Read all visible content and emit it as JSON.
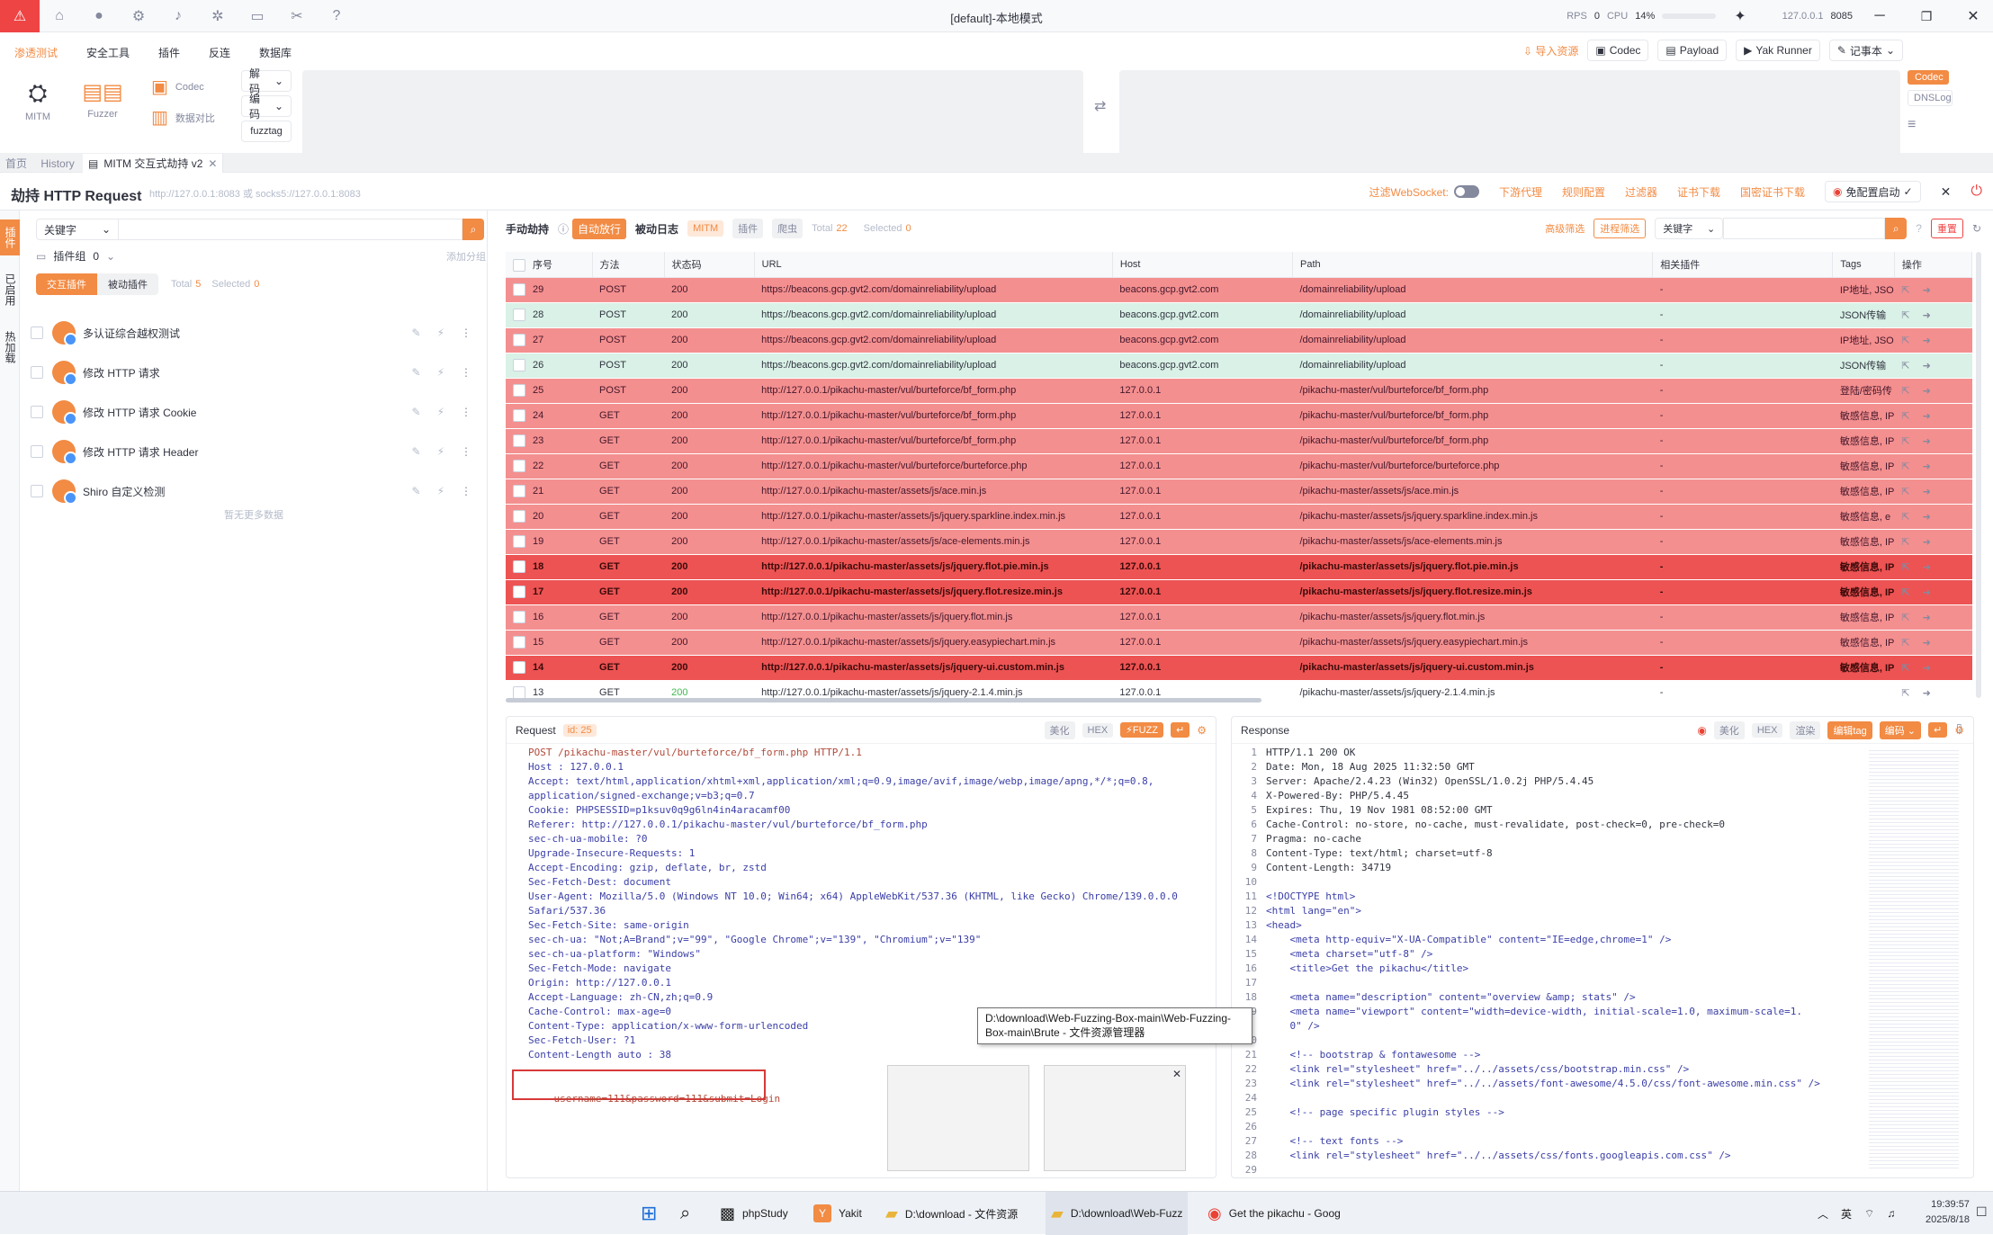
{
  "window": {
    "title": "[default]-本地模式",
    "rps_label": "RPS",
    "rps": "0",
    "cpu_label": "CPU",
    "cpu": "14%",
    "ip": "127.0.0.1",
    "port": "8085"
  },
  "menu": {
    "items": [
      "渗透测试",
      "安全工具",
      "插件",
      "反连",
      "数据库"
    ],
    "tools": {
      "mitm": "MITM",
      "fuzzer": "Fuzzer",
      "codec": "Codec",
      "compare": "数据对比"
    },
    "decode": "解码",
    "encode": "编码",
    "fuzztag": "fuzztag",
    "right": {
      "import": "导入资源",
      "codec": "Codec",
      "payload": "Payload",
      "yakrunner": "Yak Runner",
      "notebook": "记事本"
    },
    "side_tags": {
      "codec": "Codec",
      "dnslog": "DNSLog"
    }
  },
  "tabs": [
    {
      "label": "首页"
    },
    {
      "label": "History"
    },
    {
      "label": "MITM 交互式劫持 v2"
    }
  ],
  "mitm_header": {
    "title": "劫持 HTTP Request",
    "address": "http://127.0.0.1:8083 或 socks5://127.0.0.1:8083",
    "websocket_filter": "过滤WebSocket:",
    "downstream_proxy": "下游代理",
    "rule_config": "规则配置",
    "filter": "过滤器",
    "cert_download": "证书下载",
    "gm_cert_download": "国密证书下载",
    "no_config_start": "免配置启动"
  },
  "left_vtabs": [
    "插件",
    "已启用",
    "热加载"
  ],
  "left_panel": {
    "keyword": "关键字",
    "plugin_group": "插件组",
    "plugin_group_count": "0",
    "add_group": "添加分组",
    "tab_interactive": "交互插件",
    "tab_passive": "被动插件",
    "total_label": "Total",
    "total": "5",
    "selected_label": "Selected",
    "selected": "0",
    "plugins": [
      "多认证综合越权测试",
      "修改 HTTP 请求",
      "修改 HTTP 请求 Cookie",
      "修改 HTTP 请求 Header",
      "Shiro 自定义检测"
    ],
    "no_more": "暂无更多数据"
  },
  "toolbar": {
    "manual": "手动劫持",
    "auto": "自动放行",
    "passive_log": "被动日志",
    "mitm": "MITM",
    "plugin": "插件",
    "crawler": "爬虫",
    "total_label": "Total",
    "total": "22",
    "selected_label": "Selected",
    "selected": "0",
    "advanced_filter": "高级筛选",
    "process_filter": "进程筛选",
    "keyword": "关键字",
    "reset": "重置"
  },
  "table": {
    "columns": [
      "序号",
      "方法",
      "状态码",
      "URL",
      "Host",
      "Path",
      "相关插件",
      "Tags",
      "操作"
    ],
    "rows": [
      {
        "id": "29",
        "method": "POST",
        "status": "200",
        "url": "https://beacons.gcp.gvt2.com/domainreliability/upload",
        "host": "beacons.gcp.gvt2.com",
        "path": "/domainreliability/upload",
        "plugin": "-",
        "tags": "IP地址, JSO",
        "style": "red"
      },
      {
        "id": "28",
        "method": "POST",
        "status": "200",
        "url": "https://beacons.gcp.gvt2.com/domainreliability/upload",
        "host": "beacons.gcp.gvt2.com",
        "path": "/domainreliability/upload",
        "plugin": "-",
        "tags": "JSON传输",
        "style": "green"
      },
      {
        "id": "27",
        "method": "POST",
        "status": "200",
        "url": "https://beacons.gcp.gvt2.com/domainreliability/upload",
        "host": "beacons.gcp.gvt2.com",
        "path": "/domainreliability/upload",
        "plugin": "-",
        "tags": "IP地址, JSO",
        "style": "red"
      },
      {
        "id": "26",
        "method": "POST",
        "status": "200",
        "url": "https://beacons.gcp.gvt2.com/domainreliability/upload",
        "host": "beacons.gcp.gvt2.com",
        "path": "/domainreliability/upload",
        "plugin": "-",
        "tags": "JSON传输",
        "style": "green"
      },
      {
        "id": "25",
        "method": "POST",
        "status": "200",
        "url": "http://127.0.0.1/pikachu-master/vul/burteforce/bf_form.php",
        "host": "127.0.0.1",
        "path": "/pikachu-master/vul/burteforce/bf_form.php",
        "plugin": "-",
        "tags": "登陆/密码传",
        "style": "red"
      },
      {
        "id": "24",
        "method": "GET",
        "status": "200",
        "url": "http://127.0.0.1/pikachu-master/vul/burteforce/bf_form.php",
        "host": "127.0.0.1",
        "path": "/pikachu-master/vul/burteforce/bf_form.php",
        "plugin": "-",
        "tags": "敏感信息, IP",
        "style": "red"
      },
      {
        "id": "23",
        "method": "GET",
        "status": "200",
        "url": "http://127.0.0.1/pikachu-master/vul/burteforce/bf_form.php",
        "host": "127.0.0.1",
        "path": "/pikachu-master/vul/burteforce/bf_form.php",
        "plugin": "-",
        "tags": "敏感信息, IP",
        "style": "red"
      },
      {
        "id": "22",
        "method": "GET",
        "status": "200",
        "url": "http://127.0.0.1/pikachu-master/vul/burteforce/burteforce.php",
        "host": "127.0.0.1",
        "path": "/pikachu-master/vul/burteforce/burteforce.php",
        "plugin": "-",
        "tags": "敏感信息, IP",
        "style": "red"
      },
      {
        "id": "21",
        "method": "GET",
        "status": "200",
        "url": "http://127.0.0.1/pikachu-master/assets/js/ace.min.js",
        "host": "127.0.0.1",
        "path": "/pikachu-master/assets/js/ace.min.js",
        "plugin": "-",
        "tags": "敏感信息, IP",
        "style": "red"
      },
      {
        "id": "20",
        "method": "GET",
        "status": "200",
        "url": "http://127.0.0.1/pikachu-master/assets/js/jquery.sparkline.index.min.js",
        "host": "127.0.0.1",
        "path": "/pikachu-master/assets/js/jquery.sparkline.index.min.js",
        "plugin": "-",
        "tags": "敏感信息, e",
        "style": "red"
      },
      {
        "id": "19",
        "method": "GET",
        "status": "200",
        "url": "http://127.0.0.1/pikachu-master/assets/js/ace-elements.min.js",
        "host": "127.0.0.1",
        "path": "/pikachu-master/assets/js/ace-elements.min.js",
        "plugin": "-",
        "tags": "敏感信息, IP",
        "style": "red"
      },
      {
        "id": "18",
        "method": "GET",
        "status": "200",
        "url": "http://127.0.0.1/pikachu-master/assets/js/jquery.flot.pie.min.js",
        "host": "127.0.0.1",
        "path": "/pikachu-master/assets/js/jquery.flot.pie.min.js",
        "plugin": "-",
        "tags": "敏感信息, IP",
        "style": "red2"
      },
      {
        "id": "17",
        "method": "GET",
        "status": "200",
        "url": "http://127.0.0.1/pikachu-master/assets/js/jquery.flot.resize.min.js",
        "host": "127.0.0.1",
        "path": "/pikachu-master/assets/js/jquery.flot.resize.min.js",
        "plugin": "-",
        "tags": "敏感信息, IP",
        "style": "red2"
      },
      {
        "id": "16",
        "method": "GET",
        "status": "200",
        "url": "http://127.0.0.1/pikachu-master/assets/js/jquery.flot.min.js",
        "host": "127.0.0.1",
        "path": "/pikachu-master/assets/js/jquery.flot.min.js",
        "plugin": "-",
        "tags": "敏感信息, IP",
        "style": "red"
      },
      {
        "id": "15",
        "method": "GET",
        "status": "200",
        "url": "http://127.0.0.1/pikachu-master/assets/js/jquery.easypiechart.min.js",
        "host": "127.0.0.1",
        "path": "/pikachu-master/assets/js/jquery.easypiechart.min.js",
        "plugin": "-",
        "tags": "敏感信息, IP",
        "style": "red"
      },
      {
        "id": "14",
        "method": "GET",
        "status": "200",
        "url": "http://127.0.0.1/pikachu-master/assets/js/jquery-ui.custom.min.js",
        "host": "127.0.0.1",
        "path": "/pikachu-master/assets/js/jquery-ui.custom.min.js",
        "plugin": "-",
        "tags": "敏感信息, IP",
        "style": "red2"
      },
      {
        "id": "13",
        "method": "GET",
        "status": "200",
        "url": "http://127.0.0.1/pikachu-master/assets/js/jquery-2.1.4.min.js",
        "host": "127.0.0.1",
        "path": "/pikachu-master/assets/js/jquery-2.1.4.min.js",
        "plugin": "-",
        "tags": "",
        "style": "white"
      }
    ]
  },
  "request": {
    "title": "Request",
    "id_label": "id: 25",
    "beautify": "美化",
    "hex": "HEX",
    "fuzz": "FUZZ",
    "lines": [
      "POST /pikachu-master/vul/burteforce/bf_form.php HTTP/1.1",
      "Host : 127.0.0.1",
      "Accept: text/html,application/xhtml+xml,application/xml;q=0.9,image/avif,image/webp,image/apng,*/*;q=0.8,",
      "application/signed-exchange;v=b3;q=0.7",
      "Cookie: PHPSESSID=p1ksuv0q9g6ln4in4aracamf00",
      "Referer: http://127.0.0.1/pikachu-master/vul/burteforce/bf_form.php",
      "sec-ch-ua-mobile: ?0",
      "Upgrade-Insecure-Requests: 1",
      "Accept-Encoding: gzip, deflate, br, zstd",
      "Sec-Fetch-Dest: document",
      "User-Agent: Mozilla/5.0 (Windows NT 10.0; Win64; x64) AppleWebKit/537.36 (KHTML, like Gecko) Chrome/139.0.0.0",
      "Safari/537.36",
      "Sec-Fetch-Site: same-origin",
      "sec-ch-ua: \"Not;A=Brand\";v=\"99\", \"Google Chrome\";v=\"139\", \"Chromium\";v=\"139\"",
      "sec-ch-ua-platform: \"Windows\"",
      "Sec-Fetch-Mode: navigate",
      "Origin: http://127.0.0.1",
      "Accept-Language: zh-CN,zh;q=0.9",
      "Cache-Control: max-age=0",
      "Content-Type: application/x-www-form-urlencoded",
      "Sec-Fetch-User: ?1",
      "Content-Length auto : 38"
    ],
    "body": "username=111&password=111&submit=Login"
  },
  "response": {
    "title": "Response",
    "beautify": "美化",
    "hex": "HEX",
    "render": "渲染",
    "edit_tag": "编辑tag",
    "encode": "编码",
    "lines": [
      {
        "n": "1",
        "t": "HTTP/1.1 200 OK"
      },
      {
        "n": "2",
        "t": "Date: Mon, 18 Aug 2025 11:32:50 GMT"
      },
      {
        "n": "3",
        "t": "Server: Apache/2.4.23 (Win32) OpenSSL/1.0.2j PHP/5.4.45"
      },
      {
        "n": "4",
        "t": "X-Powered-By: PHP/5.4.45"
      },
      {
        "n": "5",
        "t": "Expires: Thu, 19 Nov 1981 08:52:00 GMT"
      },
      {
        "n": "6",
        "t": "Cache-Control: no-store, no-cache, must-revalidate, post-check=0, pre-check=0"
      },
      {
        "n": "7",
        "t": "Pragma: no-cache"
      },
      {
        "n": "8",
        "t": "Content-Type: text/html; charset=utf-8"
      },
      {
        "n": "9",
        "t": "Content-Length: 34719"
      },
      {
        "n": "10",
        "t": ""
      },
      {
        "n": "11",
        "t": "<!DOCTYPE html>"
      },
      {
        "n": "12",
        "t": "<html lang=\"en\">"
      },
      {
        "n": "13",
        "t": "<head>"
      },
      {
        "n": "14",
        "t": "    <meta http-equiv=\"X-UA-Compatible\" content=\"IE=edge,chrome=1\" />"
      },
      {
        "n": "15",
        "t": "    <meta charset=\"utf-8\" />"
      },
      {
        "n": "16",
        "t": "    <title>Get the pikachu</title>"
      },
      {
        "n": "17",
        "t": ""
      },
      {
        "n": "18",
        "t": "    <meta name=\"description\" content=\"overview &amp; stats\" />"
      },
      {
        "n": "19",
        "t": "    <meta name=\"viewport\" content=\"width=device-width, initial-scale=1.0, maximum-scale=1."
      },
      {
        "n": "",
        "t": "    0\" />"
      },
      {
        "n": "20",
        "t": ""
      },
      {
        "n": "21",
        "t": "    <!-- bootstrap & fontawesome -->"
      },
      {
        "n": "22",
        "t": "    <link rel=\"stylesheet\" href=\"../../assets/css/bootstrap.min.css\" />"
      },
      {
        "n": "23",
        "t": "    <link rel=\"stylesheet\" href=\"../../assets/font-awesome/4.5.0/css/font-awesome.min.css\" />"
      },
      {
        "n": "24",
        "t": ""
      },
      {
        "n": "25",
        "t": "    <!-- page specific plugin styles -->"
      },
      {
        "n": "26",
        "t": ""
      },
      {
        "n": "27",
        "t": "    <!-- text fonts -->"
      },
      {
        "n": "28",
        "t": "    <link rel=\"stylesheet\" href=\"../../assets/css/fonts.googleapis.com.css\" />"
      },
      {
        "n": "29",
        "t": ""
      }
    ]
  },
  "tooltip": "D:\\download\\Web-Fuzzing-Box-main\\Web-Fuzzing-Box-main\\Brute - 文件资源管理器",
  "taskbar": {
    "apps": [
      "phpStudy",
      "Yakit",
      "D:\\download - 文件资源",
      "D:\\download\\Web-Fuzz",
      "Get the pikachu - Goog"
    ],
    "ime": "英",
    "time": "19:39:57",
    "date": "2025/8/18"
  }
}
